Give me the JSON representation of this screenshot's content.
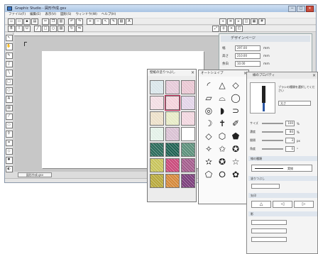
{
  "window": {
    "title": "Graphic Studio - 図形作成.gsv",
    "controls": [
      "−",
      "□",
      "×"
    ]
  },
  "menu": [
    "ファイル(F)",
    "編集(E)",
    "表示(V)",
    "図形(S)",
    "ウィンドウ(W)",
    "ヘルプ(H)"
  ],
  "toolbar_icons": [
    "new-icon",
    "open-icon",
    "save-icon",
    "print-icon",
    "cut-icon",
    "copy-icon",
    "paste-icon",
    "undo-icon",
    "redo-icon",
    "zoom-in-icon",
    "zoom-out-icon",
    "select-icon",
    "pen-icon",
    "eraser-icon",
    "text-icon"
  ],
  "document_tab": "図形作成.gsv",
  "design_panel": {
    "title": "デザインページ",
    "rows": [
      {
        "label": "幅",
        "value": "297.00",
        "unit": "mm"
      },
      {
        "label": "高さ",
        "value": "210.00",
        "unit": "mm"
      },
      {
        "label": "余白",
        "value": "10.00",
        "unit": "mm"
      }
    ]
  },
  "wallpaper_palette": {
    "title": "壁紙の塗りつぶし",
    "close": "×",
    "swatches": [
      "#d9e6ea",
      "#e5c9d8",
      "#e9c6d2",
      "#f2dde3",
      "#f4d1da",
      "#e2d4e8",
      "#ece0c9",
      "#e7ebc6",
      "#f2d6df",
      "#e3f1e8",
      "#d9c1d3",
      "#ffffff",
      "#2a6a5a",
      "#1f6152",
      "#5b8f7a",
      "#c7c35a",
      "#c9497a",
      "#a35c8c",
      "#b7a83b",
      "#d4883a",
      "#7a3d7a"
    ]
  },
  "autoshape_palette": {
    "title": "オートシェイプ",
    "close": "×",
    "shapes": [
      "◜",
      "△",
      "◇",
      "▱",
      "⌓",
      "◯",
      "◎",
      "◗",
      "⊃",
      "☽",
      "✝",
      "✐",
      "◇",
      "⬡",
      "⬟",
      "✧",
      "✩",
      "✪",
      "✫",
      "✪",
      "☆",
      "⬠",
      "⭘",
      "✿"
    ]
  },
  "properties_panel": {
    "title": "線のプロパティ",
    "close": "×",
    "brush_note": "ブラシの種類を選択してください",
    "width_label": "太さ",
    "rows": [
      {
        "label": "サイズ",
        "value": "100",
        "unit": "%"
      },
      {
        "label": "濃度",
        "value": "80",
        "unit": "%"
      },
      {
        "label": "間隔",
        "value": "3",
        "unit": "px"
      },
      {
        "label": "角度",
        "value": "0",
        "unit": "°"
      }
    ],
    "sections": [
      "線の種類",
      "塗りつぶし",
      "矢印",
      "影"
    ],
    "sample_label": "実線"
  }
}
